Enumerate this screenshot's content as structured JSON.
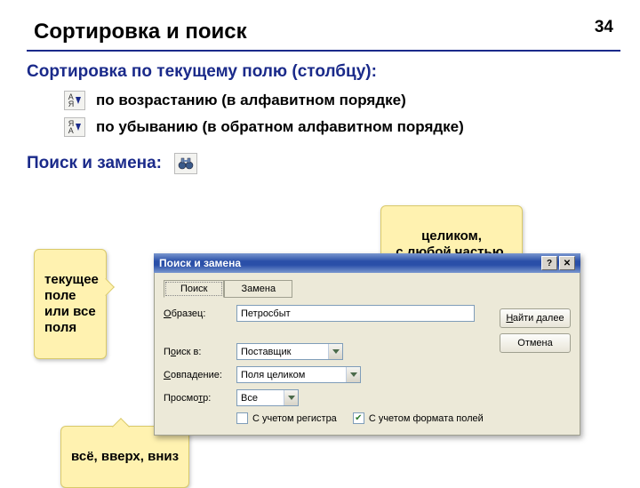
{
  "page_num": "34",
  "title": "Сортировка и поиск",
  "section1": "Сортировка по текущему полю (столбцу):",
  "asc_label": "по возрастанию (в алфавитном порядке)",
  "desc_label": "по убыванию (в обратном алфавитном порядке)",
  "section2": "Поиск и замена:",
  "callout1": "текущее поле или все поля",
  "callout2": "целиком,\nс любой частью,\nс началом",
  "callout3": "всё, вверх, вниз",
  "dialog": {
    "title": "Поиск и замена",
    "tab_find": "Поиск",
    "tab_replace": "Замена",
    "lbl_sample": "Образец:",
    "val_sample": "Петросбыт",
    "lbl_searchin": "Поиск в:",
    "val_searchin": "Поставщик",
    "lbl_match": "Совпадение:",
    "val_match": "Поля целиком",
    "lbl_direction": "Просмотр:",
    "val_direction": "Все",
    "chk_case": "С учетом регистра",
    "chk_fmt": "С учетом формата полей",
    "btn_findnext": "Найти далее",
    "btn_cancel": "Отмена"
  }
}
